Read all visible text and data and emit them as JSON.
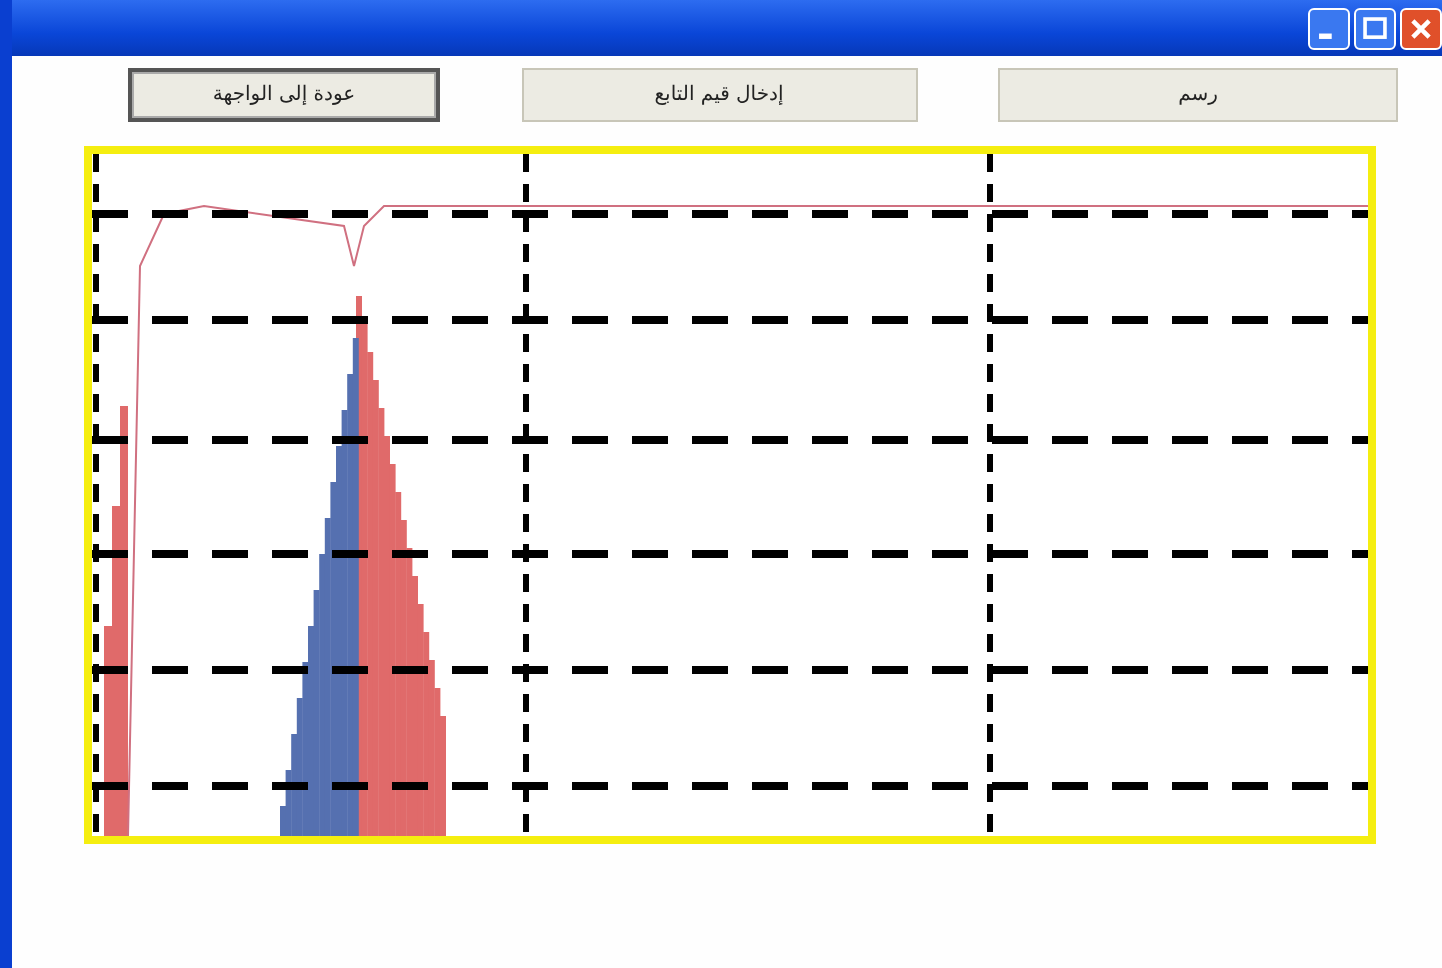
{
  "buttons": [
    {
      "label": "رسم",
      "focused": false
    },
    {
      "label": "إدخال قيم التابع",
      "focused": false
    },
    {
      "label": "عودة إلى الواجهة",
      "focused": true
    }
  ]
}
